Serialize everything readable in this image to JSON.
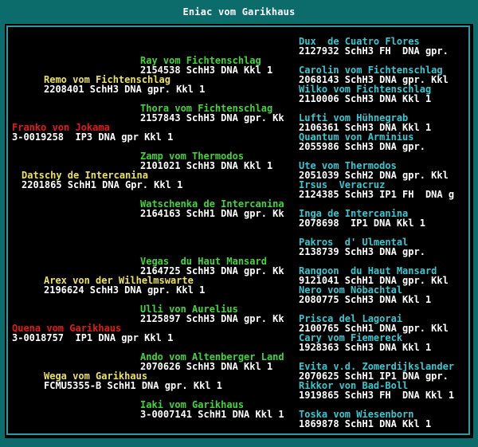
{
  "window": {
    "title": "Eniac vom Garikhaus"
  },
  "pedigree": {
    "gen1": [
      {
        "name": "Franko von Jokama",
        "info": "3-0019258  IP3 DNA gpr Kkl 1"
      },
      {
        "name": "Quena vom Garikhaus",
        "info": "3-0018757  IP1 DNA gpr Kkl 1"
      }
    ],
    "gen2": [
      {
        "name": "Remo vom Fichtenschlag",
        "info": "2208401 SchH3 DNA gpr. Kkl 1"
      },
      {
        "name": "Datschy de Intercanina",
        "info": "2201865 SchH1 DNA Gpr. Kkl 1"
      },
      {
        "name": "Arex von der Wilhelmswarte",
        "info": "2196624 SchH3 DNA gpr. Kkl 1"
      },
      {
        "name": "Wega vom Garikhaus",
        "info": "FCMU5355-B SchH1 DNA gpr. Kkl 1"
      }
    ],
    "gen3": [
      {
        "name": "Ray vom Fichtenschlag",
        "info": "2154538 SchH3 DNA Kkl 1"
      },
      {
        "name": "Thora vom Fichtenschlag",
        "info": "2157843 SchH3 DNA gpr. Kk"
      },
      {
        "name": "Zamp vom Thermodos",
        "info": "2101021 SchH3 DNA Kkl 1"
      },
      {
        "name": "Watschenka de Intercanina",
        "info": "2164163 SchH1 DNA gpr. Kk"
      },
      {
        "name": "Vegas  du Haut Mansard",
        "info": "2164725 SchH3 DNA gpr. Kk"
      },
      {
        "name": "Ulli von Aurelius",
        "info": "2125897 SchH3 DNA gpr. Kk"
      },
      {
        "name": "Ando vom Altenberger Land",
        "info": "2070626 SchH3 DNA Kkl 1"
      },
      {
        "name": "Iaki vom Garikhaus",
        "info": "3-0007141 SchH1 DNA Kkl 1"
      }
    ],
    "gen4": [
      {
        "name": "Dux  de Cuatro Flores",
        "info": "2127932 SchH3 FH  DNA gpr."
      },
      {
        "name": "Carolin vom Fichtenschlag",
        "info": "2068143 SchH3 DNA gpr. Kkl"
      },
      {
        "name": "Wilko vom Fichtenschlag",
        "info": "2110006 SchH3 DNA Kkl 1"
      },
      {
        "name": "Lufti vom Hühnegrab",
        "info": "2106361 SchH3 DNA Kkl 1"
      },
      {
        "name": "Quantum von Arminius",
        "info": "2055986 SchH3 DNA gpr."
      },
      {
        "name": "Ute vom Thermodos",
        "info": "2051039 SchH2 DNA gpr. Kkl"
      },
      {
        "name": "Irsus  Veracruz",
        "info": "2124385 SchH3 IP1 FH  DNA g"
      },
      {
        "name": "Inga de Intercanina",
        "info": "2078698  IP1 DNA Kkl 1"
      },
      {
        "name": "Pakros  d' Ulmental",
        "info": "2138739 SchH3 DNA gpr."
      },
      {
        "name": "Rangoon  du Haut Mansard",
        "info": "9121041 SchH1 DNA gpr. Kkl"
      },
      {
        "name": "Nero vom Nöbachtal",
        "info": "2080775 SchH3 DNA Kkl 1"
      },
      {
        "name": "Prisca del Lagorai",
        "info": "2100765 SchH1 DNA gpr. Kkl"
      },
      {
        "name": "Cary vom Fiemereck",
        "info": "1928363 SchH3 DNA Kkl 1"
      },
      {
        "name": "Evita v.d. Zomerdijkslander",
        "info": "2070625 SchH1 IP1 DNA gpr."
      },
      {
        "name": "Rikkor von Bad-Boll",
        "info": "1919865 SchH3 FH  DNA Kkl 1"
      },
      {
        "name": "Toska vom Wiesenborn",
        "info": "1869878 SchH1 DNA Kkl 1"
      }
    ]
  },
  "colors": {
    "titlebar_bg": "#0c6b6b",
    "pane_bg": "#000000",
    "gen1_name": "#e21a1a",
    "gen2_name": "#ece25a",
    "gen3_name": "#43d43a",
    "gen4_name": "#37c8d2",
    "info_text": "#ffffff"
  }
}
